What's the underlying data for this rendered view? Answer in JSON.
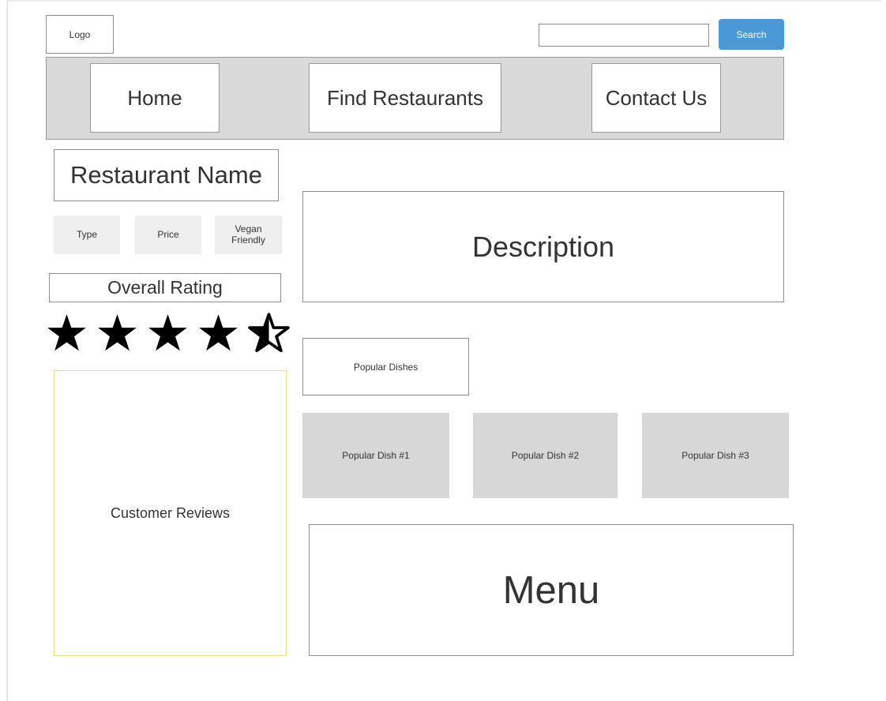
{
  "header": {
    "logo": "Logo",
    "search": {
      "value": "",
      "placeholder": "",
      "button_label": "Search"
    }
  },
  "nav": {
    "items": [
      {
        "label": "Home"
      },
      {
        "label": "Find Restaurants"
      },
      {
        "label": "Contact Us"
      }
    ]
  },
  "restaurant": {
    "name": "Restaurant Name",
    "chips": {
      "type": "Type",
      "price": "Price",
      "vegan": "Vegan Friendly"
    },
    "overall_rating_label": "Overall Rating",
    "rating": {
      "value": 4.5,
      "max": 5
    }
  },
  "reviews": {
    "label": "Customer Reviews"
  },
  "description": {
    "label": "Description"
  },
  "popular": {
    "label": "Popular Dishes",
    "dishes": [
      {
        "label": "Popular Dish #1"
      },
      {
        "label": "Popular Dish #2"
      },
      {
        "label": "Popular Dish #3"
      }
    ]
  },
  "menu": {
    "label": "Menu"
  },
  "colors": {
    "search_button": "#4a99d6",
    "nav_bar": "#d9d9d9",
    "dish_tile": "#d7d7d7",
    "chip": "#efefef",
    "reviews_border": "#ebe07a",
    "star": "#000000"
  }
}
